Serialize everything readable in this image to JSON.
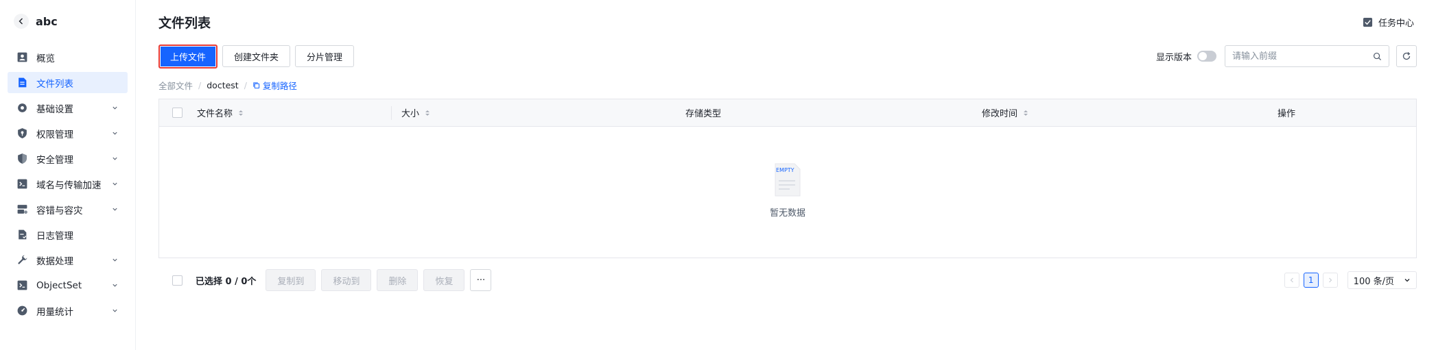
{
  "sidebar": {
    "title": "abc",
    "items": [
      {
        "label": "概览",
        "icon": "overview-icon",
        "expandable": false,
        "active": false
      },
      {
        "label": "文件列表",
        "icon": "file-list-icon",
        "expandable": false,
        "active": true
      },
      {
        "label": "基础设置",
        "icon": "gear-icon",
        "expandable": true,
        "active": false
      },
      {
        "label": "权限管理",
        "icon": "shield-key-icon",
        "expandable": true,
        "active": false
      },
      {
        "label": "安全管理",
        "icon": "shield-icon",
        "expandable": true,
        "active": false
      },
      {
        "label": "域名与传输加速",
        "icon": "terminal-icon",
        "expandable": true,
        "active": false
      },
      {
        "label": "容错与容灾",
        "icon": "database-icon",
        "expandable": true,
        "active": false
      },
      {
        "label": "日志管理",
        "icon": "log-icon",
        "expandable": false,
        "active": false
      },
      {
        "label": "数据处理",
        "icon": "wrench-icon",
        "expandable": true,
        "active": false
      },
      {
        "label": "ObjectSet",
        "icon": "terminal-icon",
        "expandable": true,
        "active": false
      },
      {
        "label": "用量统计",
        "icon": "gauge-icon",
        "expandable": true,
        "active": false
      }
    ]
  },
  "header": {
    "title": "文件列表",
    "task_center": "任务中心"
  },
  "toolbar": {
    "upload": "上传文件",
    "create_folder": "创建文件夹",
    "multipart": "分片管理",
    "show_version": "显示版本",
    "search_placeholder": "请输入前缀"
  },
  "breadcrumb": {
    "root": "全部文件",
    "current": "doctest",
    "copy_path": "复制路径"
  },
  "table": {
    "columns": [
      "文件名称",
      "大小",
      "存储类型",
      "修改时间",
      "操作"
    ],
    "empty_text": "暂无数据",
    "empty_illustration_text": "EMPTY"
  },
  "footer": {
    "selected": "已选择 0 / 0个",
    "copy_to": "复制到",
    "move_to": "移动到",
    "delete": "删除",
    "restore": "恢复",
    "more": "···",
    "current_page": "1",
    "page_size": "100 条/页"
  },
  "colors": {
    "accent": "#1664ff",
    "highlight_border": "#e53935"
  }
}
